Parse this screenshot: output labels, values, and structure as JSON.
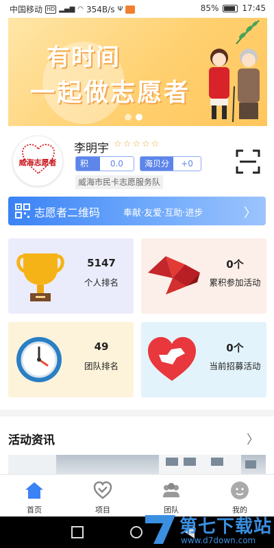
{
  "status_bar": {
    "carrier": "中国移动",
    "network": "HD",
    "speed": "354B/s",
    "battery": "85%",
    "time": "17:45"
  },
  "banner": {
    "line1": "有时间",
    "line2": "一起做志愿者",
    "slides": 2,
    "active_slide": 2,
    "colors": {
      "accent": "#ffc65c"
    }
  },
  "profile": {
    "avatar_logo": "威海志愿者",
    "name": "李明宇",
    "stars": "☆☆☆☆☆",
    "points_label": "积分",
    "points_value": "0.0",
    "haibei_label": "海贝分",
    "haibei_value": "+0",
    "team": "威海市民卡志愿服务队",
    "scan_icon": "scan-icon"
  },
  "qr_banner": {
    "title": "志愿者二维码",
    "slogan": "奉献·友爱·互助·进步",
    "arrow": "〉"
  },
  "stats": [
    {
      "value": "5147",
      "label": "个人排名",
      "icon": "trophy-icon"
    },
    {
      "value": "0个",
      "label": "累积参加活动",
      "icon": "dove-icon"
    },
    {
      "value": "49",
      "label": "团队排名",
      "icon": "clock-icon"
    },
    {
      "value": "0个",
      "label": "当前招募活动",
      "icon": "heart-hand-icon"
    }
  ],
  "news": {
    "title": "活动资讯",
    "arrow": "〉"
  },
  "tabs": [
    {
      "label": "首页",
      "icon": "home-icon",
      "active": true
    },
    {
      "label": "项目",
      "icon": "heart-outline-icon",
      "active": false
    },
    {
      "label": "团队",
      "icon": "team-icon",
      "active": false
    },
    {
      "label": "我的",
      "icon": "profile-icon",
      "active": false
    }
  ],
  "watermark": {
    "text": "第七下载站",
    "url": "www.d7down.com"
  },
  "colors": {
    "primary": "#3a82f5",
    "brand_red": "#c8151d",
    "star": "#f4a63a"
  }
}
